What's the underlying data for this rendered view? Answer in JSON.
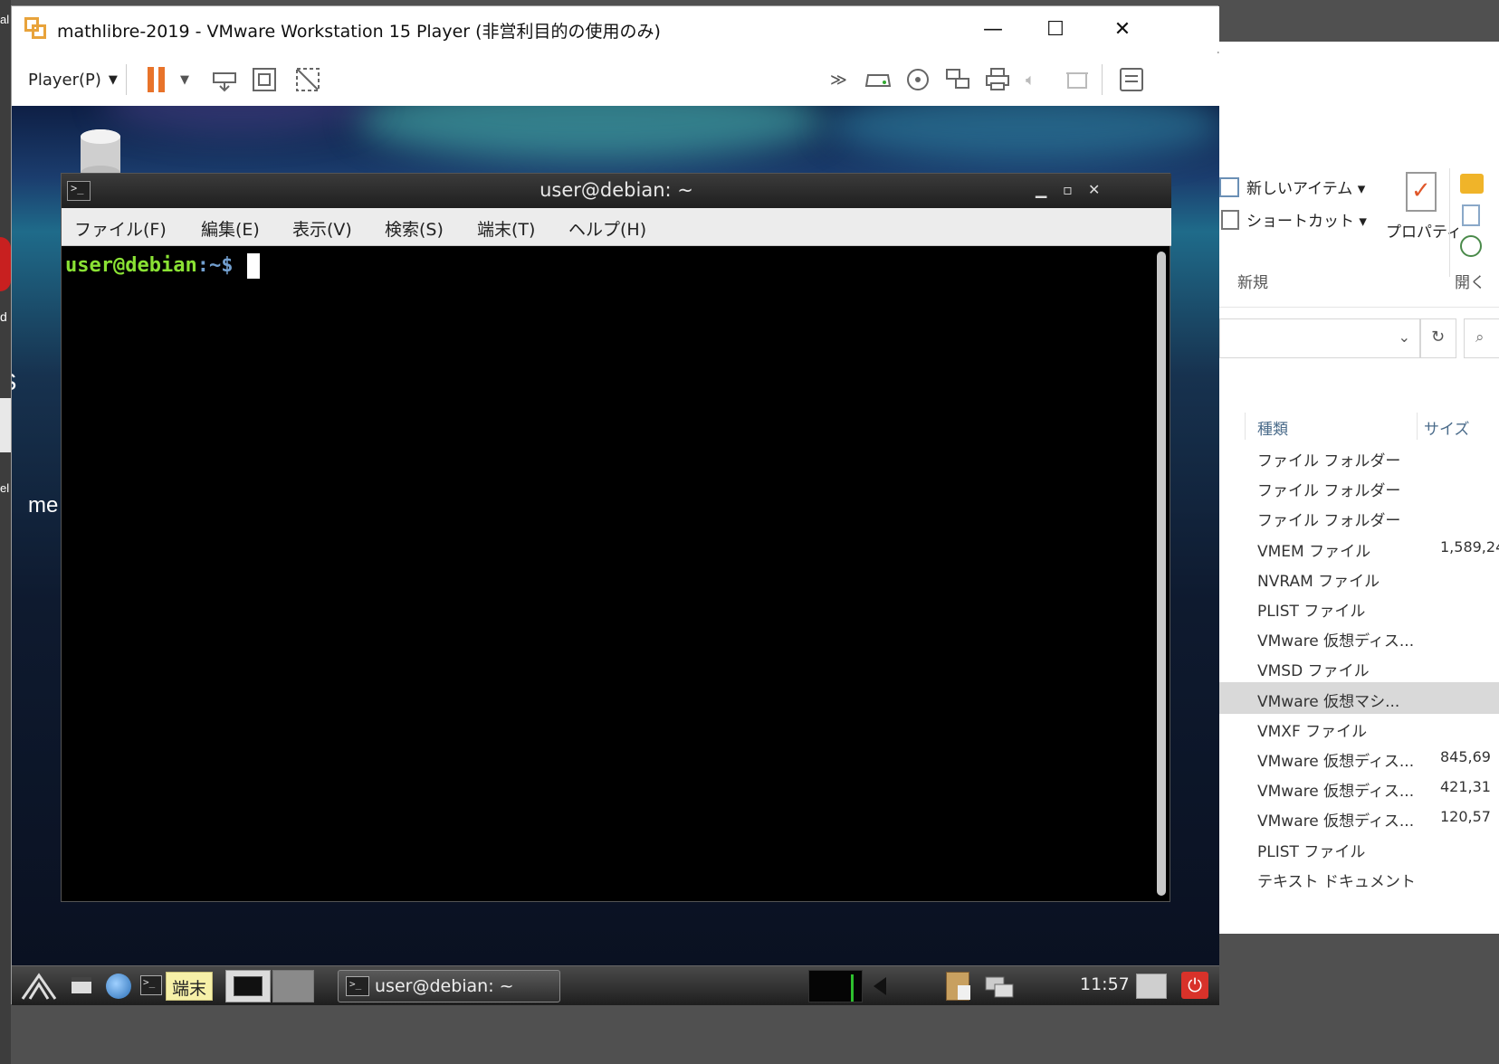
{
  "vmware": {
    "title": "mathlibre-2019 - VMware Workstation 15 Player (非営利目的の使用のみ)",
    "player_menu": "Player(P)"
  },
  "desktop_left": {
    "frag_top": "al",
    "frag_d": "d",
    "frag_s": "S",
    "frag_el": "el",
    "frag_me": "me"
  },
  "explorer": {
    "new_item": "新しいアイテム",
    "shortcut": "ショートカット",
    "properties": "プロパティ",
    "group_new": "新規",
    "group_open": "開く",
    "col_type": "種類",
    "col_size": "サイズ",
    "rows": [
      {
        "type": "ファイル フォルダー",
        "size": ""
      },
      {
        "type": "ファイル フォルダー",
        "size": ""
      },
      {
        "type": "ファイル フォルダー",
        "size": ""
      },
      {
        "type": "VMEM ファイル",
        "size": "1,589,24"
      },
      {
        "type": "NVRAM ファイル",
        "size": ""
      },
      {
        "type": "PLIST ファイル",
        "size": ""
      },
      {
        "type": "VMware 仮想ディス...",
        "size": ""
      },
      {
        "type": "VMSD ファイル",
        "size": ""
      },
      {
        "type": "VMware 仮想マシ...",
        "size": ""
      },
      {
        "type": "VMXF ファイル",
        "size": ""
      },
      {
        "type": "VMware 仮想ディス...",
        "size": "845,69"
      },
      {
        "type": "VMware 仮想ディス...",
        "size": "421,31"
      },
      {
        "type": "VMware 仮想ディス...",
        "size": "120,57"
      },
      {
        "type": "PLIST ファイル",
        "size": ""
      },
      {
        "type": "テキスト ドキュメント",
        "size": ""
      }
    ]
  },
  "terminal": {
    "title": "user@debian: ~",
    "menus": [
      "ファイル(F)",
      "編集(E)",
      "表示(V)",
      "検索(S)",
      "端末(T)",
      "ヘルプ(H)"
    ],
    "prompt_user": "user@debian",
    "prompt_path": ":~$ "
  },
  "guest_taskbar": {
    "launcher_label": "端末",
    "task_label": "user@debian: ~",
    "clock": "11:57"
  },
  "colors": {
    "prompt_green": "#8ae234",
    "prompt_blue": "#729fcf",
    "pause_orange": "#e8732a",
    "selected_row": "#d9d9d9",
    "power_red": "#d8322a"
  }
}
